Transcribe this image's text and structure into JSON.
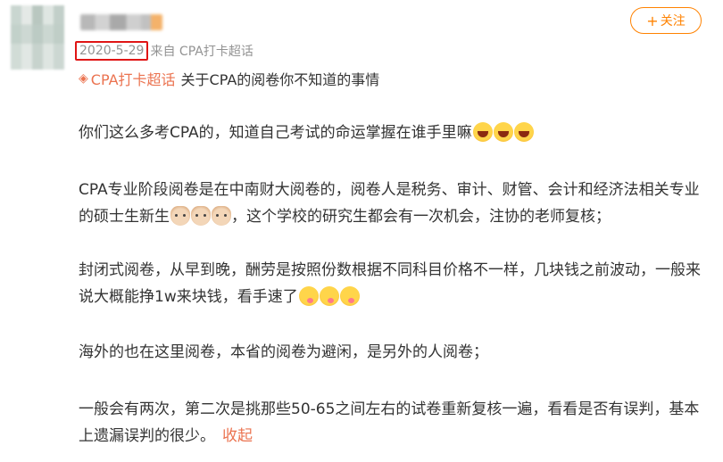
{
  "post": {
    "date": "2020-5-29",
    "source": "来自 CPA打卡超话",
    "follow_label": "关注",
    "follow_plus": "+",
    "topic_link": "CPA打卡超话",
    "topic_title": "关于CPA的阅卷你不知道的事情",
    "paragraphs": {
      "p1": "你们这么多考CPA的，知道自己考试的命运掌握在谁手里嘛",
      "p2a": "CPA专业阶段阅卷是在中南财大阅卷的，阅卷人是税务、审计、财管、会计和经济法相关专业的硕士生新生",
      "p2b": "，这个学校的研究生都会有一次机会，注协的老师复核；",
      "p3": "封闭式阅卷，从早到晚，酬劳是按照份数根据不同科目价格不一样，几块钱之前波动，一般来说大概能挣1w来块钱，看手速了",
      "p4": "海外的也在这里阅卷，本省的阅卷为避闲，是另外的人阅卷；",
      "p5": "一般会有两次，第二次是挑那些50-65之间左右的试卷重新复核一遍，看看是否有误判，基本上遗漏误判的很少。"
    },
    "collapse_label": "收起"
  }
}
